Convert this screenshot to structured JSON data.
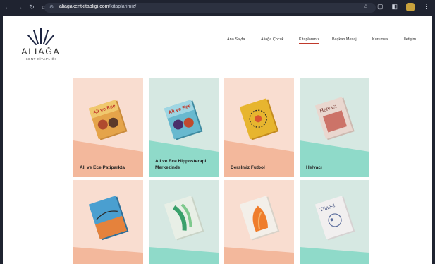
{
  "browser": {
    "url_host": "aliagakentkitapligi.com",
    "url_path": "/kitaplarimiz/"
  },
  "site": {
    "logo_name": "ALIAĞA",
    "logo_sub": "KENT KİTAPLIĞI"
  },
  "nav": [
    {
      "label": "Ana Sayfa"
    },
    {
      "label": "Aliağa Çocuk"
    },
    {
      "label": "Kitaplarımız"
    },
    {
      "label": "Başkan Mesajı"
    },
    {
      "label": "Kurumsal"
    },
    {
      "label": "İletişim"
    }
  ],
  "cards": [
    {
      "title": "Ali ve Ece Patiparkta",
      "bg": "#f9ddd0",
      "wedge": "#f3b89c",
      "cover": "#e5a44a",
      "cover_text": "Ali ve Ece"
    },
    {
      "title": "Ali ve Ece Hipposterapi Merkezinde",
      "bg": "#d6e8e2",
      "wedge": "#8fdac9",
      "cover": "#68b9cf",
      "cover_text": "Ali ve Ece"
    },
    {
      "title": "Derslmiz Futbol",
      "bg": "#f9ddd0",
      "wedge": "#f3b89c",
      "cover": "#e7b52f",
      "cover_text": ""
    },
    {
      "title": "Helvacı",
      "bg": "#d6e8e2",
      "wedge": "#8fdac9",
      "cover": "#e9d7cf",
      "cover_text": "Helvacı"
    },
    {
      "title": "",
      "bg": "#f9ddd0",
      "wedge": "#f3b89c",
      "cover": "#4a9fd0",
      "cover_text": ""
    },
    {
      "title": "",
      "bg": "#d6e8e2",
      "wedge": "#8fdac9",
      "cover": "#e8efe6",
      "cover_text": ""
    },
    {
      "title": "",
      "bg": "#f9ddd0",
      "wedge": "#f3b89c",
      "cover": "#f3efe9",
      "cover_text": ""
    },
    {
      "title": "",
      "bg": "#d6e8e2",
      "wedge": "#8fdac9",
      "cover": "#f1efef",
      "cover_text": "Tüne-1"
    }
  ]
}
